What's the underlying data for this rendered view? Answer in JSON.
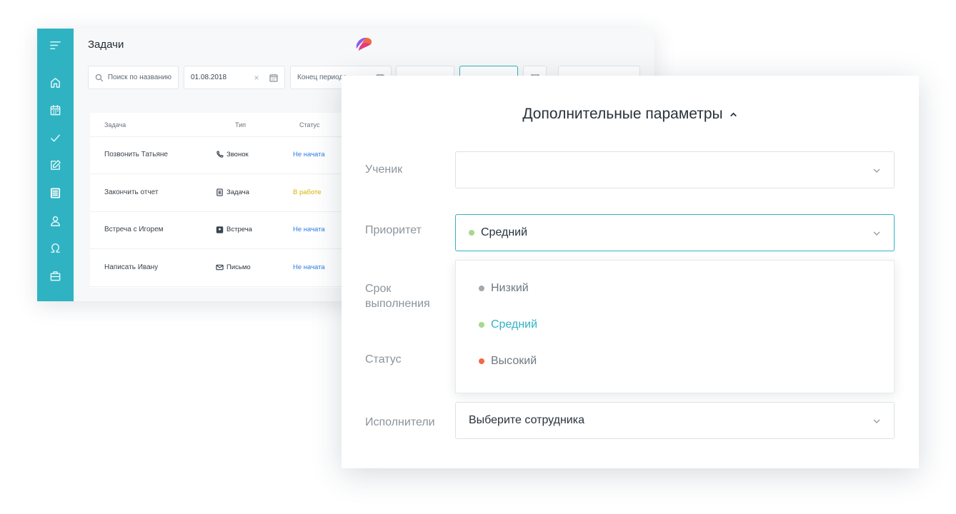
{
  "colors": {
    "accent": "#2fb3c3",
    "status_not_started": "#2a7de1",
    "status_in_progress": "#d9b200",
    "priority_low": "#a2a9ae",
    "priority_medium": "#a6d88d",
    "priority_high": "#ef6a45"
  },
  "sidebar": {
    "icons": [
      "menu-icon",
      "home-icon",
      "calendar-icon",
      "check-icon",
      "edit-icon",
      "tasks-icon",
      "user-icon",
      "omega-icon",
      "briefcase-icon"
    ],
    "active": "tasks-icon"
  },
  "tasks_page": {
    "title": "Задачи",
    "filters": {
      "search_placeholder": "Поиск по названию",
      "date_start": "01.08.2018",
      "date_end_placeholder": "Конец периода"
    },
    "table": {
      "columns": [
        "Задача",
        "Тип",
        "Статус"
      ],
      "rows": [
        {
          "task": "Позвонить Татьяне",
          "type": "Звонок",
          "type_icon": "phone-icon",
          "status": "Не начата"
        },
        {
          "task": "Закончить отчет",
          "type": "Задача",
          "type_icon": "task-icon",
          "status": "В работе"
        },
        {
          "task": "Встреча с Игорем",
          "type": "Встреча",
          "type_icon": "meeting-icon",
          "status": "Не начата"
        },
        {
          "task": "Написать Ивану",
          "type": "Письмо",
          "type_icon": "mail-icon",
          "status": "Не начата"
        }
      ]
    }
  },
  "modal": {
    "title": "Дополнительные параметры",
    "labels": {
      "student": "Ученик",
      "priority": "Приоритет",
      "deadline": "Срок выполнения",
      "status": "Статус",
      "executors": "Исполнители"
    },
    "student_value": "",
    "priority_value": "Средний",
    "priority_options": [
      "Низкий",
      "Средний",
      "Высокий"
    ],
    "executors_placeholder": "Выберите сотрудника"
  }
}
